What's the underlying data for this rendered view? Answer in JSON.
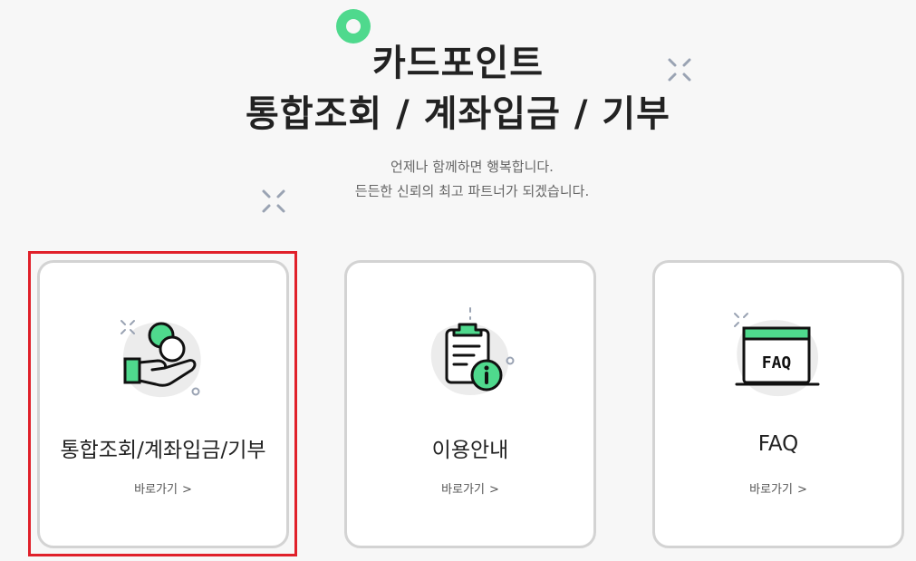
{
  "hero": {
    "title_line1": "카드포인트",
    "title_line2": "통합조회 / 계좌입금 / 기부",
    "subtitle_line1": "언제나 함께하면 행복합니다.",
    "subtitle_line2": "든든한 신뢰의 최고 파트너가 되겠습니다."
  },
  "cards": [
    {
      "title": "통합조회/계좌입금/기부",
      "link_label": "바로가기",
      "link_chevron": ">",
      "icon": "hand-coin-icon",
      "highlighted": true
    },
    {
      "title": "이용안내",
      "link_label": "바로가기",
      "link_chevron": ">",
      "icon": "clipboard-info-icon",
      "highlighted": false
    },
    {
      "title": "FAQ",
      "link_label": "바로가기",
      "link_chevron": ">",
      "icon": "faq-window-icon",
      "icon_text": "FAQ",
      "highlighted": false
    }
  ],
  "colors": {
    "accent_green": "#4fd98d",
    "highlight_red": "#e0202a",
    "card_border": "#d3d3d3",
    "background": "#f7f7f7"
  }
}
